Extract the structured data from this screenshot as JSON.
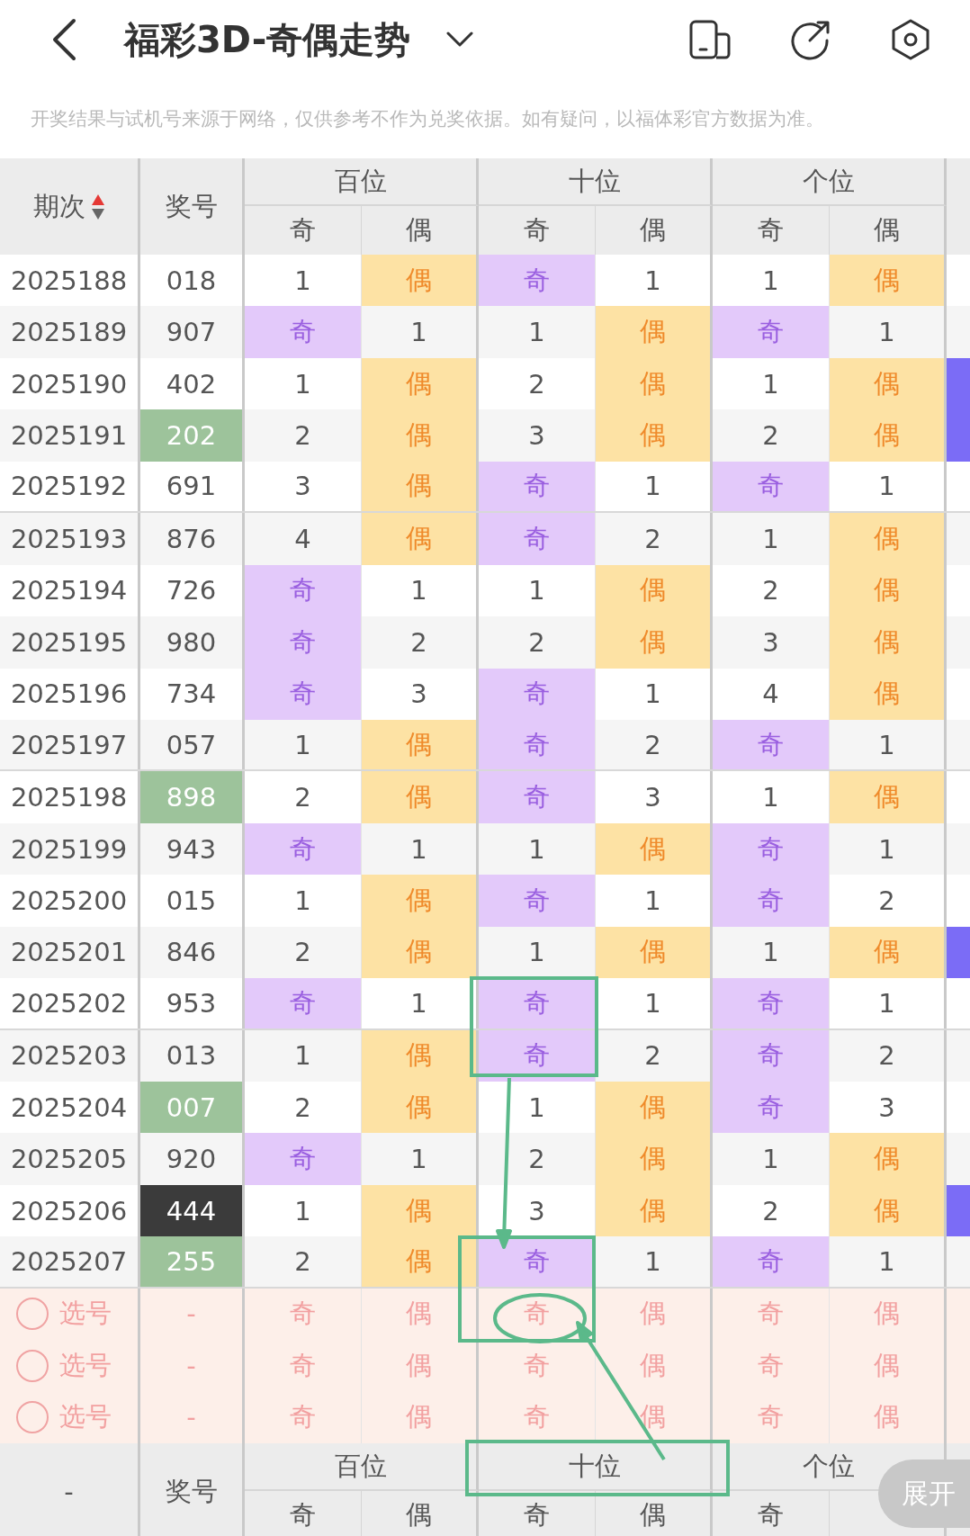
{
  "header": {
    "title": "福彩3D-奇偶走势"
  },
  "notice": "开奖结果与试机号来源于网络，仅供参考不作为兑奖依据。如有疑问，以福体彩官方数据为准。",
  "table": {
    "period_label": "期次",
    "number_label": "奖号",
    "groups": [
      {
        "label": "百位",
        "odd": "奇",
        "even": "偶"
      },
      {
        "label": "十位",
        "odd": "奇",
        "even": "偶"
      },
      {
        "label": "个位",
        "odd": "奇",
        "even": "偶"
      }
    ],
    "rows": [
      {
        "issue": "2025188",
        "number": "018",
        "repeated": false,
        "all_same": false,
        "next_column_marked": false,
        "cells": [
          {
            "kind": "gap",
            "text": "1"
          },
          {
            "kind": "even",
            "text": "偶"
          },
          {
            "kind": "odd",
            "text": "奇"
          },
          {
            "kind": "gap",
            "text": "1"
          },
          {
            "kind": "gap",
            "text": "1"
          },
          {
            "kind": "even",
            "text": "偶"
          }
        ]
      },
      {
        "issue": "2025189",
        "number": "907",
        "repeated": false,
        "all_same": false,
        "next_column_marked": false,
        "cells": [
          {
            "kind": "odd",
            "text": "奇"
          },
          {
            "kind": "gap",
            "text": "1"
          },
          {
            "kind": "gap",
            "text": "1"
          },
          {
            "kind": "even",
            "text": "偶"
          },
          {
            "kind": "odd",
            "text": "奇"
          },
          {
            "kind": "gap",
            "text": "1"
          }
        ]
      },
      {
        "issue": "2025190",
        "number": "402",
        "repeated": false,
        "all_same": false,
        "next_column_marked": true,
        "cells": [
          {
            "kind": "gap",
            "text": "1"
          },
          {
            "kind": "even",
            "text": "偶"
          },
          {
            "kind": "gap",
            "text": "2"
          },
          {
            "kind": "even",
            "text": "偶"
          },
          {
            "kind": "gap",
            "text": "1"
          },
          {
            "kind": "even",
            "text": "偶"
          }
        ]
      },
      {
        "issue": "2025191",
        "number": "202",
        "repeated": true,
        "all_same": false,
        "next_column_marked": true,
        "cells": [
          {
            "kind": "gap",
            "text": "2"
          },
          {
            "kind": "even",
            "text": "偶"
          },
          {
            "kind": "gap",
            "text": "3"
          },
          {
            "kind": "even",
            "text": "偶"
          },
          {
            "kind": "gap",
            "text": "2"
          },
          {
            "kind": "even",
            "text": "偶"
          }
        ]
      },
      {
        "issue": "2025192",
        "number": "691",
        "repeated": false,
        "all_same": false,
        "next_column_marked": false,
        "cells": [
          {
            "kind": "gap",
            "text": "3"
          },
          {
            "kind": "even",
            "text": "偶"
          },
          {
            "kind": "odd",
            "text": "奇"
          },
          {
            "kind": "gap",
            "text": "1"
          },
          {
            "kind": "odd",
            "text": "奇"
          },
          {
            "kind": "gap",
            "text": "1"
          }
        ]
      },
      {
        "issue": "2025193",
        "number": "876",
        "repeated": false,
        "all_same": false,
        "next_column_marked": false,
        "cells": [
          {
            "kind": "gap",
            "text": "4"
          },
          {
            "kind": "even",
            "text": "偶"
          },
          {
            "kind": "odd",
            "text": "奇"
          },
          {
            "kind": "gap",
            "text": "2"
          },
          {
            "kind": "gap",
            "text": "1"
          },
          {
            "kind": "even",
            "text": "偶"
          }
        ]
      },
      {
        "issue": "2025194",
        "number": "726",
        "repeated": false,
        "all_same": false,
        "next_column_marked": false,
        "cells": [
          {
            "kind": "odd",
            "text": "奇"
          },
          {
            "kind": "gap",
            "text": "1"
          },
          {
            "kind": "gap",
            "text": "1"
          },
          {
            "kind": "even",
            "text": "偶"
          },
          {
            "kind": "gap",
            "text": "2"
          },
          {
            "kind": "even",
            "text": "偶"
          }
        ]
      },
      {
        "issue": "2025195",
        "number": "980",
        "repeated": false,
        "all_same": false,
        "next_column_marked": false,
        "cells": [
          {
            "kind": "odd",
            "text": "奇"
          },
          {
            "kind": "gap",
            "text": "2"
          },
          {
            "kind": "gap",
            "text": "2"
          },
          {
            "kind": "even",
            "text": "偶"
          },
          {
            "kind": "gap",
            "text": "3"
          },
          {
            "kind": "even",
            "text": "偶"
          }
        ]
      },
      {
        "issue": "2025196",
        "number": "734",
        "repeated": false,
        "all_same": false,
        "next_column_marked": false,
        "cells": [
          {
            "kind": "odd",
            "text": "奇"
          },
          {
            "kind": "gap",
            "text": "3"
          },
          {
            "kind": "odd",
            "text": "奇"
          },
          {
            "kind": "gap",
            "text": "1"
          },
          {
            "kind": "gap",
            "text": "4"
          },
          {
            "kind": "even",
            "text": "偶"
          }
        ]
      },
      {
        "issue": "2025197",
        "number": "057",
        "repeated": false,
        "all_same": false,
        "next_column_marked": false,
        "cells": [
          {
            "kind": "gap",
            "text": "1"
          },
          {
            "kind": "even",
            "text": "偶"
          },
          {
            "kind": "odd",
            "text": "奇"
          },
          {
            "kind": "gap",
            "text": "2"
          },
          {
            "kind": "odd",
            "text": "奇"
          },
          {
            "kind": "gap",
            "text": "1"
          }
        ]
      },
      {
        "issue": "2025198",
        "number": "898",
        "repeated": true,
        "all_same": false,
        "next_column_marked": false,
        "cells": [
          {
            "kind": "gap",
            "text": "2"
          },
          {
            "kind": "even",
            "text": "偶"
          },
          {
            "kind": "odd",
            "text": "奇"
          },
          {
            "kind": "gap",
            "text": "3"
          },
          {
            "kind": "gap",
            "text": "1"
          },
          {
            "kind": "even",
            "text": "偶"
          }
        ]
      },
      {
        "issue": "2025199",
        "number": "943",
        "repeated": false,
        "all_same": false,
        "next_column_marked": false,
        "cells": [
          {
            "kind": "odd",
            "text": "奇"
          },
          {
            "kind": "gap",
            "text": "1"
          },
          {
            "kind": "gap",
            "text": "1"
          },
          {
            "kind": "even",
            "text": "偶"
          },
          {
            "kind": "odd",
            "text": "奇"
          },
          {
            "kind": "gap",
            "text": "1"
          }
        ]
      },
      {
        "issue": "2025200",
        "number": "015",
        "repeated": false,
        "all_same": false,
        "next_column_marked": false,
        "cells": [
          {
            "kind": "gap",
            "text": "1"
          },
          {
            "kind": "even",
            "text": "偶"
          },
          {
            "kind": "odd",
            "text": "奇"
          },
          {
            "kind": "gap",
            "text": "1"
          },
          {
            "kind": "odd",
            "text": "奇"
          },
          {
            "kind": "gap",
            "text": "2"
          }
        ]
      },
      {
        "issue": "2025201",
        "number": "846",
        "repeated": false,
        "all_same": false,
        "next_column_marked": true,
        "cells": [
          {
            "kind": "gap",
            "text": "2"
          },
          {
            "kind": "even",
            "text": "偶"
          },
          {
            "kind": "gap",
            "text": "1"
          },
          {
            "kind": "even",
            "text": "偶"
          },
          {
            "kind": "gap",
            "text": "1"
          },
          {
            "kind": "even",
            "text": "偶"
          }
        ]
      },
      {
        "issue": "2025202",
        "number": "953",
        "repeated": false,
        "all_same": false,
        "next_column_marked": false,
        "cells": [
          {
            "kind": "odd",
            "text": "奇"
          },
          {
            "kind": "gap",
            "text": "1"
          },
          {
            "kind": "odd",
            "text": "奇"
          },
          {
            "kind": "gap",
            "text": "1"
          },
          {
            "kind": "odd",
            "text": "奇"
          },
          {
            "kind": "gap",
            "text": "1"
          }
        ]
      },
      {
        "issue": "2025203",
        "number": "013",
        "repeated": false,
        "all_same": false,
        "next_column_marked": false,
        "cells": [
          {
            "kind": "gap",
            "text": "1"
          },
          {
            "kind": "even",
            "text": "偶"
          },
          {
            "kind": "odd",
            "text": "奇"
          },
          {
            "kind": "gap",
            "text": "2"
          },
          {
            "kind": "odd",
            "text": "奇"
          },
          {
            "kind": "gap",
            "text": "2"
          }
        ]
      },
      {
        "issue": "2025204",
        "number": "007",
        "repeated": true,
        "all_same": false,
        "next_column_marked": false,
        "cells": [
          {
            "kind": "gap",
            "text": "2"
          },
          {
            "kind": "even",
            "text": "偶"
          },
          {
            "kind": "gap",
            "text": "1"
          },
          {
            "kind": "even",
            "text": "偶"
          },
          {
            "kind": "odd",
            "text": "奇"
          },
          {
            "kind": "gap",
            "text": "3"
          }
        ]
      },
      {
        "issue": "2025205",
        "number": "920",
        "repeated": false,
        "all_same": false,
        "next_column_marked": false,
        "cells": [
          {
            "kind": "odd",
            "text": "奇"
          },
          {
            "kind": "gap",
            "text": "1"
          },
          {
            "kind": "gap",
            "text": "2"
          },
          {
            "kind": "even",
            "text": "偶"
          },
          {
            "kind": "gap",
            "text": "1"
          },
          {
            "kind": "even",
            "text": "偶"
          }
        ]
      },
      {
        "issue": "2025206",
        "number": "444",
        "repeated": true,
        "all_same": true,
        "next_column_marked": true,
        "cells": [
          {
            "kind": "gap",
            "text": "1"
          },
          {
            "kind": "even",
            "text": "偶"
          },
          {
            "kind": "gap",
            "text": "3"
          },
          {
            "kind": "even",
            "text": "偶"
          },
          {
            "kind": "gap",
            "text": "2"
          },
          {
            "kind": "even",
            "text": "偶"
          }
        ]
      },
      {
        "issue": "2025207",
        "number": "255",
        "repeated": true,
        "all_same": false,
        "next_column_marked": false,
        "cells": [
          {
            "kind": "gap",
            "text": "2"
          },
          {
            "kind": "even",
            "text": "偶"
          },
          {
            "kind": "odd",
            "text": "奇"
          },
          {
            "kind": "gap",
            "text": "1"
          },
          {
            "kind": "odd",
            "text": "奇"
          },
          {
            "kind": "gap",
            "text": "1"
          }
        ]
      }
    ],
    "pick_rows": [
      {
        "selected": false,
        "label": "选号",
        "number": "-",
        "cells": [
          "奇",
          "偶",
          "奇",
          "偶",
          "奇",
          "偶"
        ]
      },
      {
        "selected": false,
        "label": "选号",
        "number": "-",
        "cells": [
          "奇",
          "偶",
          "奇",
          "偶",
          "奇",
          "偶"
        ]
      },
      {
        "selected": false,
        "label": "选号",
        "number": "-",
        "cells": [
          "奇",
          "偶",
          "奇",
          "偶",
          "奇",
          "偶"
        ]
      }
    ]
  },
  "footer_header": {
    "period": "-",
    "number_label": "奖号",
    "groups": [
      "百位",
      "十位",
      "个位"
    ],
    "subs": [
      "奇",
      "偶",
      "奇",
      "偶",
      "奇"
    ]
  },
  "expand_button": "展开"
}
